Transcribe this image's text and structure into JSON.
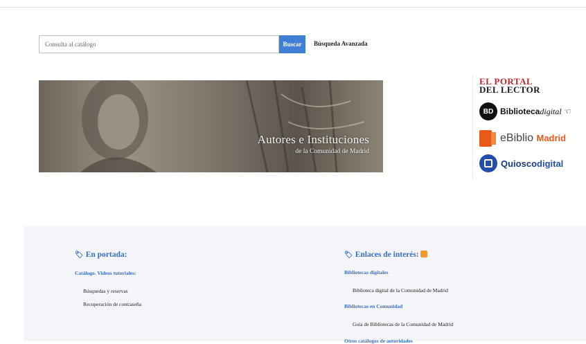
{
  "search": {
    "placeholder": "Consulta al catálogo",
    "button_label": "Buscar",
    "advanced_label": "Búsqueda Avanzada"
  },
  "banner": {
    "title": "Autores e Instituciones",
    "subtitle": "de la Comunidad de Madrid"
  },
  "side_logos": {
    "portal_line1": "EL PORTAL",
    "portal_line2": "DEL LECTOR",
    "bd_badge": "BD",
    "bd_bold": "Biblioteca",
    "bd_italic": "digital",
    "ebiblio_prefix": "eBiblio",
    "ebiblio_city": "Madrid",
    "kiosco_a": "Quiosco",
    "kiosco_b": "digital"
  },
  "footer": {
    "left": {
      "title": "En portada:",
      "subtitle": "Catálogo. Videos tutoriales:",
      "items": [
        "Búsquedas y reservas",
        "Recuperación de contraseña"
      ]
    },
    "right": {
      "title": "Enlaces de interés:",
      "groups": [
        {
          "heading": "Bibliotecas digitales",
          "item": "Biblioteca digital de la Comunidad de Madrid"
        },
        {
          "heading": "Bibliotecas en Comunidad",
          "item": "Guía de Bibliotecas de la Comunidad de Madrid"
        },
        {
          "heading": "Otros catálogos de autoridades"
        }
      ]
    }
  }
}
